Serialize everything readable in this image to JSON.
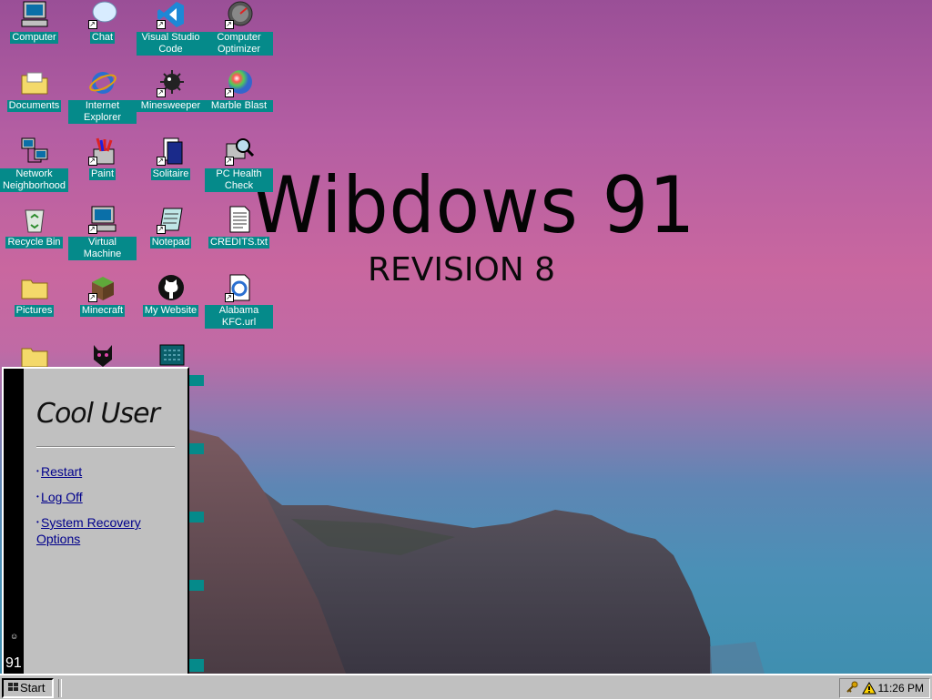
{
  "logo": {
    "title": "Wibdows 91",
    "subtitle": "REVISION 8"
  },
  "desktop_icons": [
    {
      "label": "Computer",
      "icon": "computer-icon"
    },
    {
      "label": "Chat",
      "icon": "chat-icon"
    },
    {
      "label": "Visual Studio Code",
      "icon": "vscode-icon"
    },
    {
      "label": "Computer Optimizer",
      "icon": "optimizer-icon"
    },
    {
      "label": "Documents",
      "icon": "documents-folder-icon"
    },
    {
      "label": "Internet Explorer",
      "icon": "internet-explorer-icon"
    },
    {
      "label": "Minesweeper",
      "icon": "minesweeper-icon"
    },
    {
      "label": "Marble Blast",
      "icon": "marble-blast-icon"
    },
    {
      "label": "Network Neighborhood",
      "icon": "network-icon"
    },
    {
      "label": "Paint",
      "icon": "paint-icon"
    },
    {
      "label": "Solitaire",
      "icon": "solitaire-icon"
    },
    {
      "label": "PC Health Check",
      "icon": "pc-health-check-icon"
    },
    {
      "label": "Recycle Bin",
      "icon": "recycle-bin-icon"
    },
    {
      "label": "Virtual Machine",
      "icon": "virtual-machine-icon"
    },
    {
      "label": "Notepad",
      "icon": "notepad-icon"
    },
    {
      "label": "CREDITS.txt",
      "icon": "text-file-icon"
    },
    {
      "label": "Pictures",
      "icon": "pictures-folder-icon"
    },
    {
      "label": "Minecraft",
      "icon": "minecraft-icon"
    },
    {
      "label": "My Website",
      "icon": "github-icon"
    },
    {
      "label": "Alabama KFC.url",
      "icon": "url-shortcut-icon"
    }
  ],
  "start_menu": {
    "user_name": "Cool User",
    "links": [
      {
        "label": "Restart"
      },
      {
        "label": "Log Off"
      },
      {
        "label": "System Recovery Options"
      }
    ],
    "sidebar_text": "91",
    "sidebar_glyph": "☺"
  },
  "taskbar": {
    "start_label": "Start",
    "clock": "11:26 PM",
    "tray_icons": [
      "key-icon",
      "warning-icon"
    ]
  }
}
